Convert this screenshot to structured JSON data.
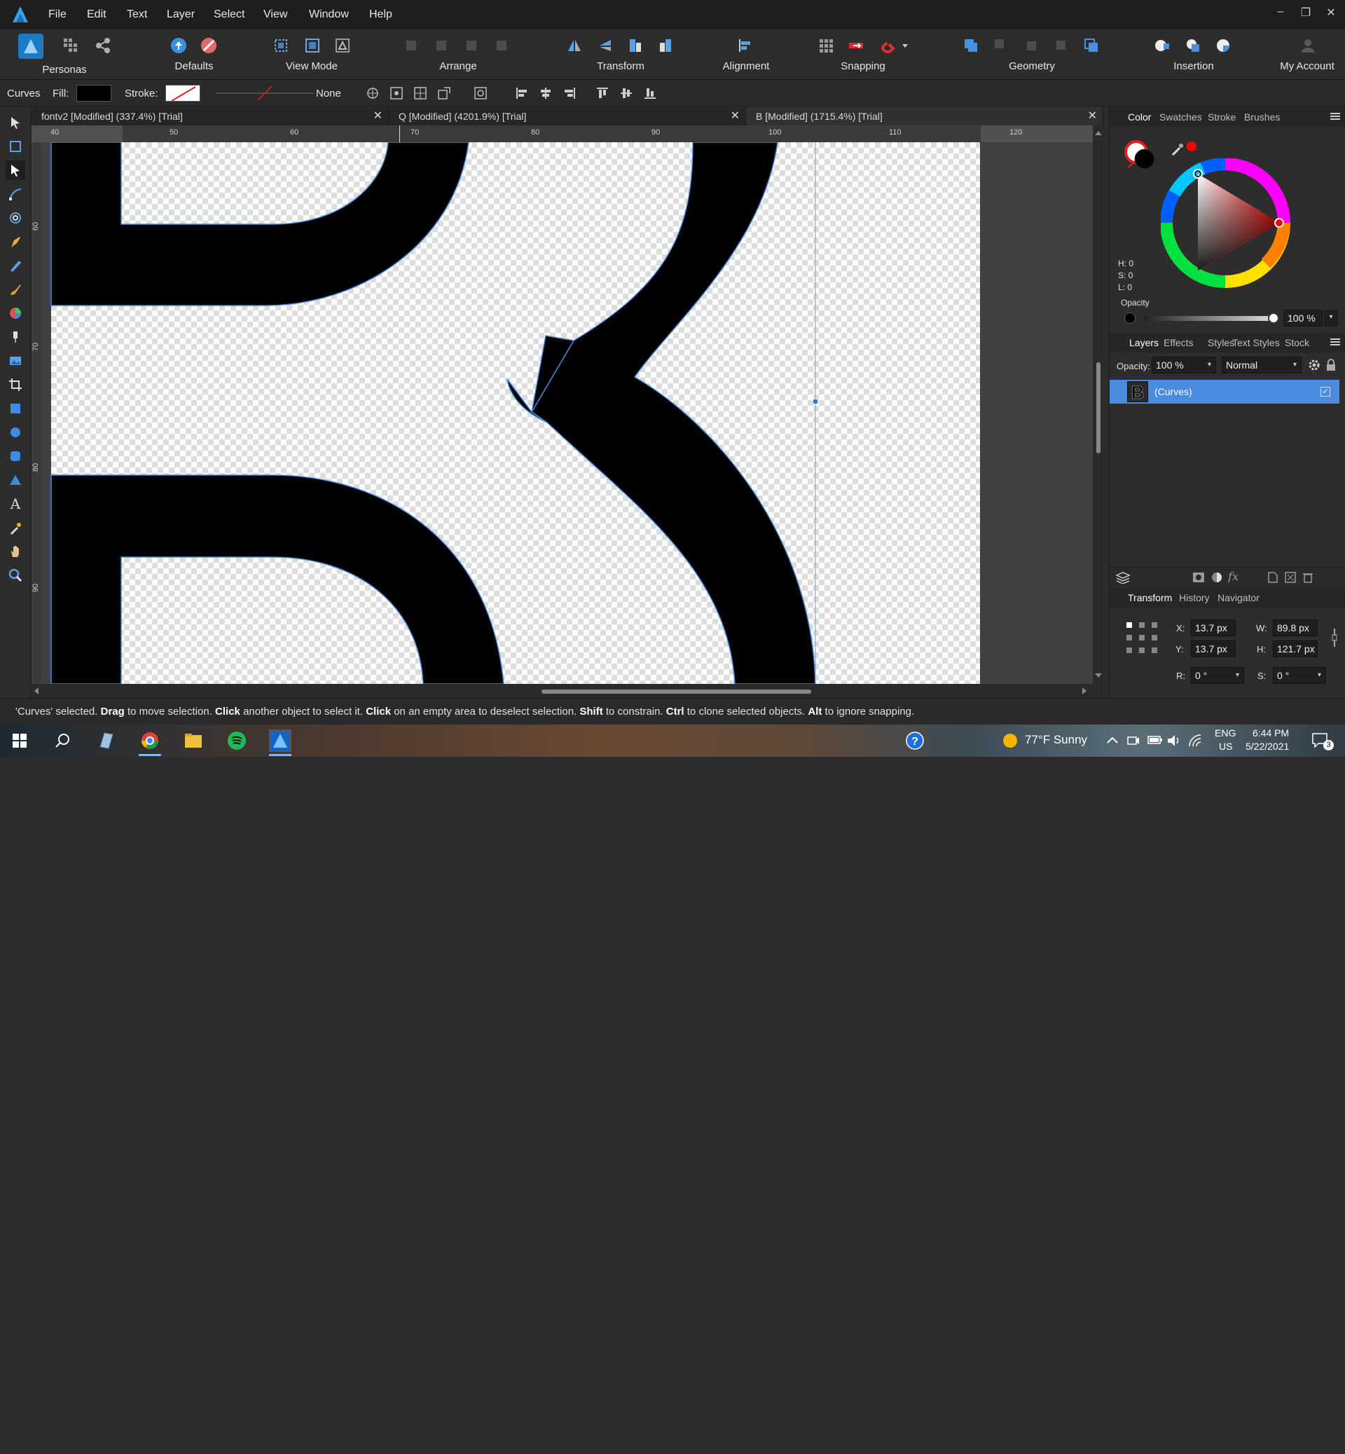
{
  "menu": {
    "items": [
      "File",
      "Edit",
      "Text",
      "Layer",
      "Select",
      "View",
      "Window",
      "Help"
    ],
    "window_controls": [
      "–",
      "❐",
      "✕"
    ]
  },
  "toolbar": {
    "groups": [
      "Personas",
      "Defaults",
      "View Mode",
      "Arrange",
      "Transform",
      "Alignment",
      "Snapping",
      "Geometry",
      "Insertion",
      "My Account"
    ]
  },
  "context": {
    "tool_name": "Curves",
    "fill_label": "Fill:",
    "stroke_label": "Stroke:",
    "stroke_value": "None",
    "fill_color": "#000000"
  },
  "tabs": [
    {
      "title": "fontv2 [Modified] (337.4%) [Trial]",
      "close": "✕"
    },
    {
      "title": "Q [Modified] (4201.9%) [Trial]",
      "close": "✕"
    },
    {
      "title": "B [Modified] (1715.4%) [Trial]",
      "close": "✕"
    }
  ],
  "ruler": {
    "h_labels": [
      "40",
      "50",
      "60",
      "70",
      "80",
      "90",
      "100",
      "110",
      "120"
    ],
    "v_labels": [
      "60",
      "70",
      "80",
      "90"
    ]
  },
  "color_panel": {
    "tabs": [
      "Color",
      "Swatches",
      "Stroke",
      "Brushes"
    ],
    "hsl": [
      "H: 0",
      "S: 0",
      "L: 0"
    ],
    "opacity_label": "Opacity",
    "opacity_value": "100 %",
    "accent_color": "#ff0000"
  },
  "layers_panel": {
    "tabs": [
      "Layers",
      "Effects",
      "Styles",
      "Text Styles",
      "Stock"
    ],
    "opacity_label": "Opacity:",
    "opacity_value": "100 %",
    "blend_mode": "Normal",
    "layer_name": "(Curves)",
    "layer_thumb": "B"
  },
  "transform_panel": {
    "tabs": [
      "Transform",
      "History",
      "Navigator"
    ],
    "x_label": "X:",
    "x": "13.7 px",
    "y_label": "Y:",
    "y": "13.7 px",
    "w_label": "W:",
    "w": "89.8 px",
    "h_label": "H:",
    "h": "121.7 px",
    "r_label": "R:",
    "r": "0 °",
    "s_label": "S:",
    "s": "0 °"
  },
  "status": {
    "p1": "'Curves' selected. ",
    "b1": "Drag",
    "p2": " to move selection. ",
    "b2": "Click",
    "p3": " another object to select it. ",
    "b3": "Click",
    "p4": " on an empty area to deselect selection. ",
    "b4": "Shift",
    "p5": " to constrain. ",
    "b5": "Ctrl",
    "p6": " to clone selected objects. ",
    "b6": "Alt",
    "p7": " to ignore snapping."
  },
  "taskbar": {
    "weather": "77°F  Sunny",
    "lang1": "ENG",
    "lang2": "US",
    "time": "6:44 PM",
    "date": "5/22/2021",
    "notif_count": "3"
  }
}
